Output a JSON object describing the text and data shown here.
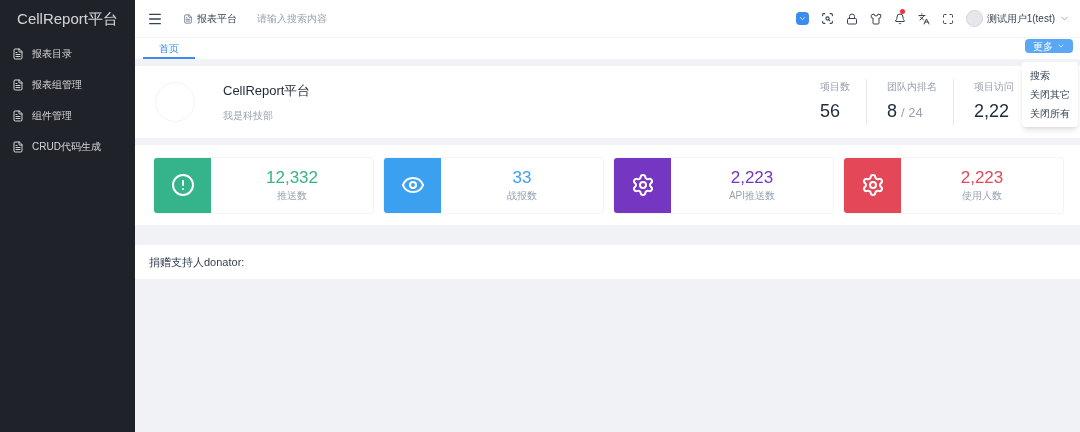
{
  "sidebar": {
    "title": "CellReport平台",
    "items": [
      {
        "label": "报表目录"
      },
      {
        "label": "报表组管理"
      },
      {
        "label": "组件管理"
      },
      {
        "label": "CRUD代码生成"
      }
    ]
  },
  "header": {
    "breadcrumb": "报表平台",
    "search": {
      "placeholder": "请输入搜索内容"
    },
    "notification_dot": true,
    "user": "测试用户1(test)"
  },
  "tabs": [
    {
      "label": "首页",
      "selected": true
    }
  ],
  "more_button": "更多",
  "menu": [
    "搜索",
    "关闭其它",
    "关闭所有"
  ],
  "profile": {
    "name": "CellReport平台",
    "department": "我是科技部",
    "stats": [
      {
        "label": "项目数",
        "value": "56"
      },
      {
        "label": "团队内排名",
        "value": "8",
        "total": "/ 24"
      },
      {
        "label": "项目访问",
        "value": "2,22"
      }
    ]
  },
  "cards": [
    {
      "kind": "alert",
      "value": "12,332",
      "label": "推送数",
      "color": "#35b48c"
    },
    {
      "kind": "eye",
      "value": "33",
      "label": "战报数",
      "color": "#3ca0f0"
    },
    {
      "kind": "gear",
      "value": "2,223",
      "label": "API推送数",
      "color": "#7536c2"
    },
    {
      "kind": "gear",
      "value": "2,223",
      "label": "使用人数",
      "color": "#e44858"
    }
  ],
  "donator": "捐赠支持人donator:"
}
